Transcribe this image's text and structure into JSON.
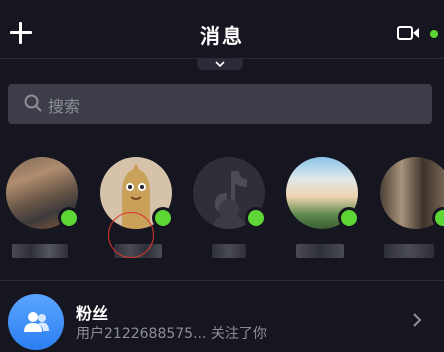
{
  "header": {
    "title": "消息",
    "add_icon": "plus-icon",
    "video_icon": "video-camera-icon",
    "video_status_color": "#5ed636"
  },
  "search": {
    "placeholder": "搜索",
    "icon": "search-icon"
  },
  "contacts": [
    {
      "status": "online"
    },
    {
      "status": "online"
    },
    {
      "status": "online"
    },
    {
      "status": "online"
    },
    {
      "status": "online"
    }
  ],
  "fans": {
    "title": "粉丝",
    "subtitle": "用户2122688575... 关注了你",
    "icon": "users-icon"
  },
  "colors": {
    "background": "#15161f",
    "online": "#5ed636",
    "search_bg": "#3c3d48",
    "fans_avatar": "#3d8cf5"
  }
}
